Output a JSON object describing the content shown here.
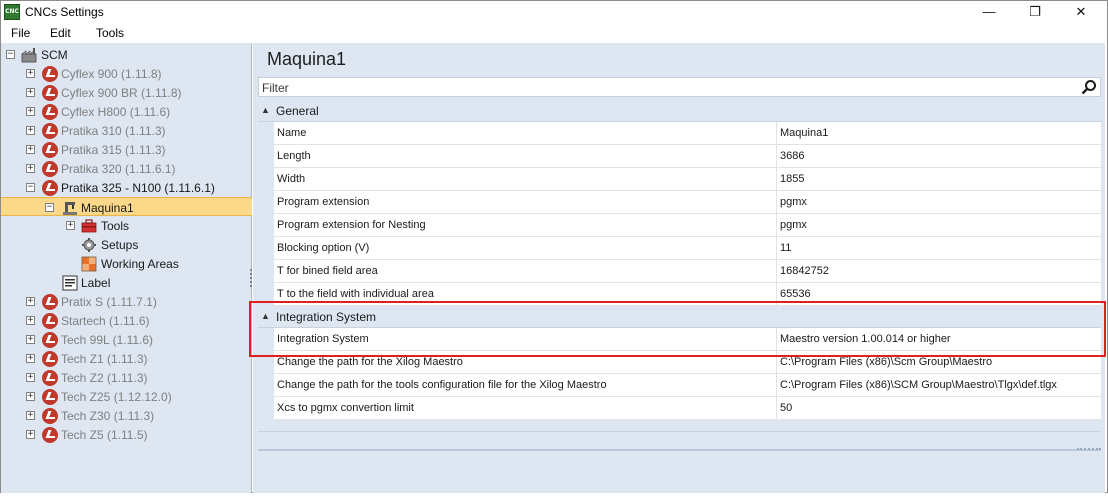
{
  "window": {
    "title": "CNCs Settings",
    "app_icon_text": "CNC",
    "controls": {
      "minimize": "—",
      "maximize": "❐",
      "close": "✕"
    }
  },
  "menu": [
    "File",
    "Edit",
    "Tools"
  ],
  "tree": {
    "root": "SCM",
    "machines_before": [
      "Cyflex 900 (1.11.8)",
      "Cyflex 900 BR (1.11.8)",
      "Cyflex H800 (1.11.6)",
      "Pratika 310 (1.11.3)",
      "Pratika 315 (1.11.3)",
      "Pratika 320 (1.11.6.1)"
    ],
    "expanded_machine": "Pratika 325 - N100 (1.11.6.1)",
    "selected_node": "Maquina1",
    "children": [
      "Tools",
      "Setups",
      "Working Areas"
    ],
    "label_node": "Label",
    "machines_after": [
      "Pratix S (1.11.7.1)",
      "Startech (1.11.6)",
      "Tech 99L (1.11.6)",
      "Tech Z1 (1.11.3)",
      "Tech Z2 (1.11.3)",
      "Tech Z25 (1.12.12.0)",
      "Tech Z30 (1.11.3)",
      "Tech Z5 (1.11.5)"
    ]
  },
  "main": {
    "title": "Maquina1",
    "filter_placeholder": "Filter",
    "categories": [
      {
        "label": "General",
        "rows": [
          {
            "name": "Name",
            "value": "Maquina1"
          },
          {
            "name": "Length",
            "value": "3686"
          },
          {
            "name": "Width",
            "value": "1855"
          },
          {
            "name": "Program extension",
            "value": "pgmx"
          },
          {
            "name": "Program extension for Nesting",
            "value": "pgmx"
          },
          {
            "name": "Blocking option (V)",
            "value": "11"
          },
          {
            "name": "T for bined field area",
            "value": "16842752"
          },
          {
            "name": "T to the field with individual area",
            "value": "65536"
          }
        ]
      },
      {
        "label": "Integration System",
        "rows": [
          {
            "name": "Integration System",
            "value": "Maestro version 1.00.014 or higher"
          },
          {
            "name": "Change the path for  the Xilog Maestro",
            "value": "C:\\Program Files (x86)\\Scm Group\\Maestro"
          },
          {
            "name": "Change the path for the tools configuration file for the Xilog Maestro",
            "value": "C:\\Program Files (x86)\\SCM Group\\Maestro\\Tlgx\\def.tlgx"
          },
          {
            "name": "Xcs to pgmx convertion limit",
            "value": "50"
          }
        ]
      }
    ]
  },
  "colors": {
    "tree_bg": "#dde6f1",
    "selection": "#fbd88a",
    "highlight": "#e02020",
    "cnc_icon": "#c0392b"
  }
}
